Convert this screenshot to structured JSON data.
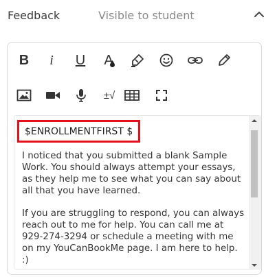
{
  "header": {
    "title": "Feedback",
    "visibility": "Visible to student"
  },
  "icons": {
    "collapse": "chevron-up-icon",
    "bold": "bold-icon",
    "italic": "italic-icon",
    "underline": "underline-icon",
    "text_color": "text-color-icon",
    "highlight": "highlighter-icon",
    "emoji": "emoji-icon",
    "link": "link-icon",
    "draw": "pencil-icon",
    "image": "image-icon",
    "video": "video-icon",
    "microphone": "microphone-icon",
    "math": "math-icon",
    "table": "table-icon",
    "fullscreen": "fullscreen-icon"
  },
  "toolbar": {
    "bold_label": "B",
    "italic_label": "i",
    "underline_label": "U",
    "text_color_label": "A",
    "math_label": "±√"
  },
  "editor": {
    "token": "$ENROLLMENTFIRST $",
    "paragraph1": "I noticed that you submitted a blank Sample Work. You should always attempt your essays, as they help me to see what you can say about all that you have learned.",
    "paragraph2": "If you are struggling to respond, you can always reach out to me for help. You can call me at 929-274-3294 or schedule a meeting with me on my YouCanBookMe page.  I am here to help. :)"
  },
  "colors": {
    "token_border": "#e3101c",
    "scrollbar_track": "#f1f1f1",
    "scrollbar_thumb": "#c1c1c1",
    "editor_border": "#d7d7d7"
  }
}
